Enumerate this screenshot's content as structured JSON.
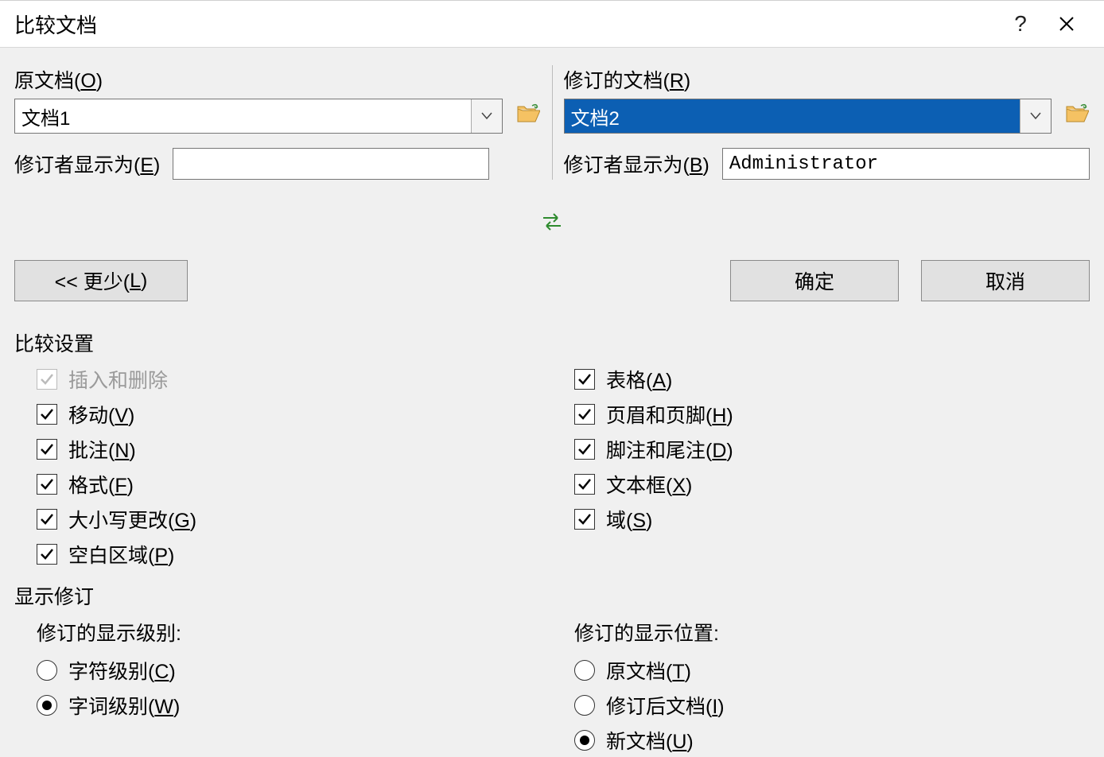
{
  "title": "比较文档",
  "help_glyph": "?",
  "close_glyph": "✕",
  "original": {
    "label_pre": "原文档(",
    "hotkey": "O",
    "label_post": ")",
    "value": "文档1"
  },
  "revised": {
    "label_pre": "修订的文档(",
    "hotkey": "R",
    "label_post": ")",
    "value": "文档2"
  },
  "reviser_left": {
    "label_pre": "修订者显示为(",
    "hotkey": "E",
    "label_post": ")",
    "value": ""
  },
  "reviser_right": {
    "label_pre": "修订者显示为(",
    "hotkey": "B",
    "label_post": ")",
    "value": "Administrator"
  },
  "buttons": {
    "less_pre": "<< 更少(",
    "less_hotkey": "L",
    "less_post": ")",
    "ok": "确定",
    "cancel": "取消"
  },
  "compare_settings_title": "比较设置",
  "settings_left": {
    "insert_delete": "插入和删除",
    "move_pre": "移动(",
    "move_hk": "V",
    "move_post": ")",
    "comment_pre": "批注(",
    "comment_hk": "N",
    "comment_post": ")",
    "format_pre": "格式(",
    "format_hk": "F",
    "format_post": ")",
    "case_pre": "大小写更改(",
    "case_hk": "G",
    "case_post": ")",
    "whitespace_pre": "空白区域(",
    "whitespace_hk": "P",
    "whitespace_post": ")"
  },
  "settings_right": {
    "table_pre": "表格(",
    "table_hk": "A",
    "table_post": ")",
    "header_pre": "页眉和页脚(",
    "header_hk": "H",
    "header_post": ")",
    "footnote_pre": "脚注和尾注(",
    "footnote_hk": "D",
    "footnote_post": ")",
    "textbox_pre": "文本框(",
    "textbox_hk": "X",
    "textbox_post": ")",
    "field_pre": "域(",
    "field_hk": "S",
    "field_post": ")"
  },
  "show_changes_title": "显示修订",
  "level": {
    "heading": "修订的显示级别:",
    "char_pre": "字符级别(",
    "char_hk": "C",
    "char_post": ")",
    "word_pre": "字词级别(",
    "word_hk": "W",
    "word_post": ")"
  },
  "location": {
    "heading": "修订的显示位置:",
    "orig_pre": "原文档(",
    "orig_hk": "T",
    "orig_post": ")",
    "rev_pre": "修订后文档(",
    "rev_hk": "I",
    "rev_post": ")",
    "new_pre": "新文档(",
    "new_hk": "U",
    "new_post": ")"
  }
}
